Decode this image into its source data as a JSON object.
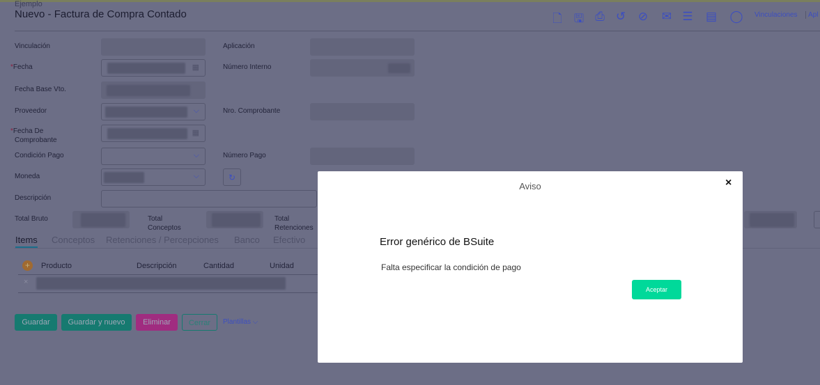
{
  "header": {
    "subtitle": "Ejemplo",
    "title": "Nuevo - Factura de Compra Contado"
  },
  "toolbar": {
    "icons": [
      "new-document-icon",
      "save-icon",
      "print-icon",
      "history-icon",
      "attach-icon",
      "mail-icon",
      "checklist-icon",
      "document-icon",
      "comment-icon"
    ],
    "links": [
      "Vinculaciones",
      "Apl"
    ]
  },
  "form": {
    "vinculacion": "Vinculación",
    "aplicacion": "Aplicación",
    "fecha": "Fecha",
    "numero_interno": "Número Interno",
    "fecha_base": "Fecha Base Vto.",
    "proveedor": "Proveedor",
    "nro_comprobante": "Nro. Comprobante",
    "fecha_comprobante_1": "Fecha De",
    "fecha_comprobante_2": "Comprobante",
    "condicion_pago": "Condición Pago",
    "numero_pago": "Número Pago",
    "moneda": "Moneda",
    "descripcion": "Descripción",
    "required_mark": "*",
    "total_bruto": "Total Bruto",
    "total_conceptos_1": "Total",
    "total_conceptos_2": "Conceptos",
    "total_retenciones_1": "Total",
    "total_retenciones_2": "Retenciones"
  },
  "tabs": [
    "Items",
    "Conceptos",
    "Retenciones / Percepciones",
    "Banco",
    "Efectivo"
  ],
  "table": {
    "headers": [
      "Producto",
      "Descripción",
      "Cantidad",
      "Unidad"
    ],
    "remove": "×"
  },
  "actions": {
    "guardar": "Guardar",
    "guardar_nuevo": "Guardar y nuevo",
    "eliminar": "Eliminar",
    "cerrar": "Cerrar",
    "plantillas": "Plantillas ⌵"
  },
  "colors": {
    "accent": "#00d99a",
    "primary": "#13a982",
    "danger": "#e0308a"
  },
  "modal": {
    "title": "Aviso",
    "close": "×",
    "heading": "Error genérico de BSuite",
    "message": "Falta especificar la condición de pago",
    "accept": "Aceptar"
  }
}
